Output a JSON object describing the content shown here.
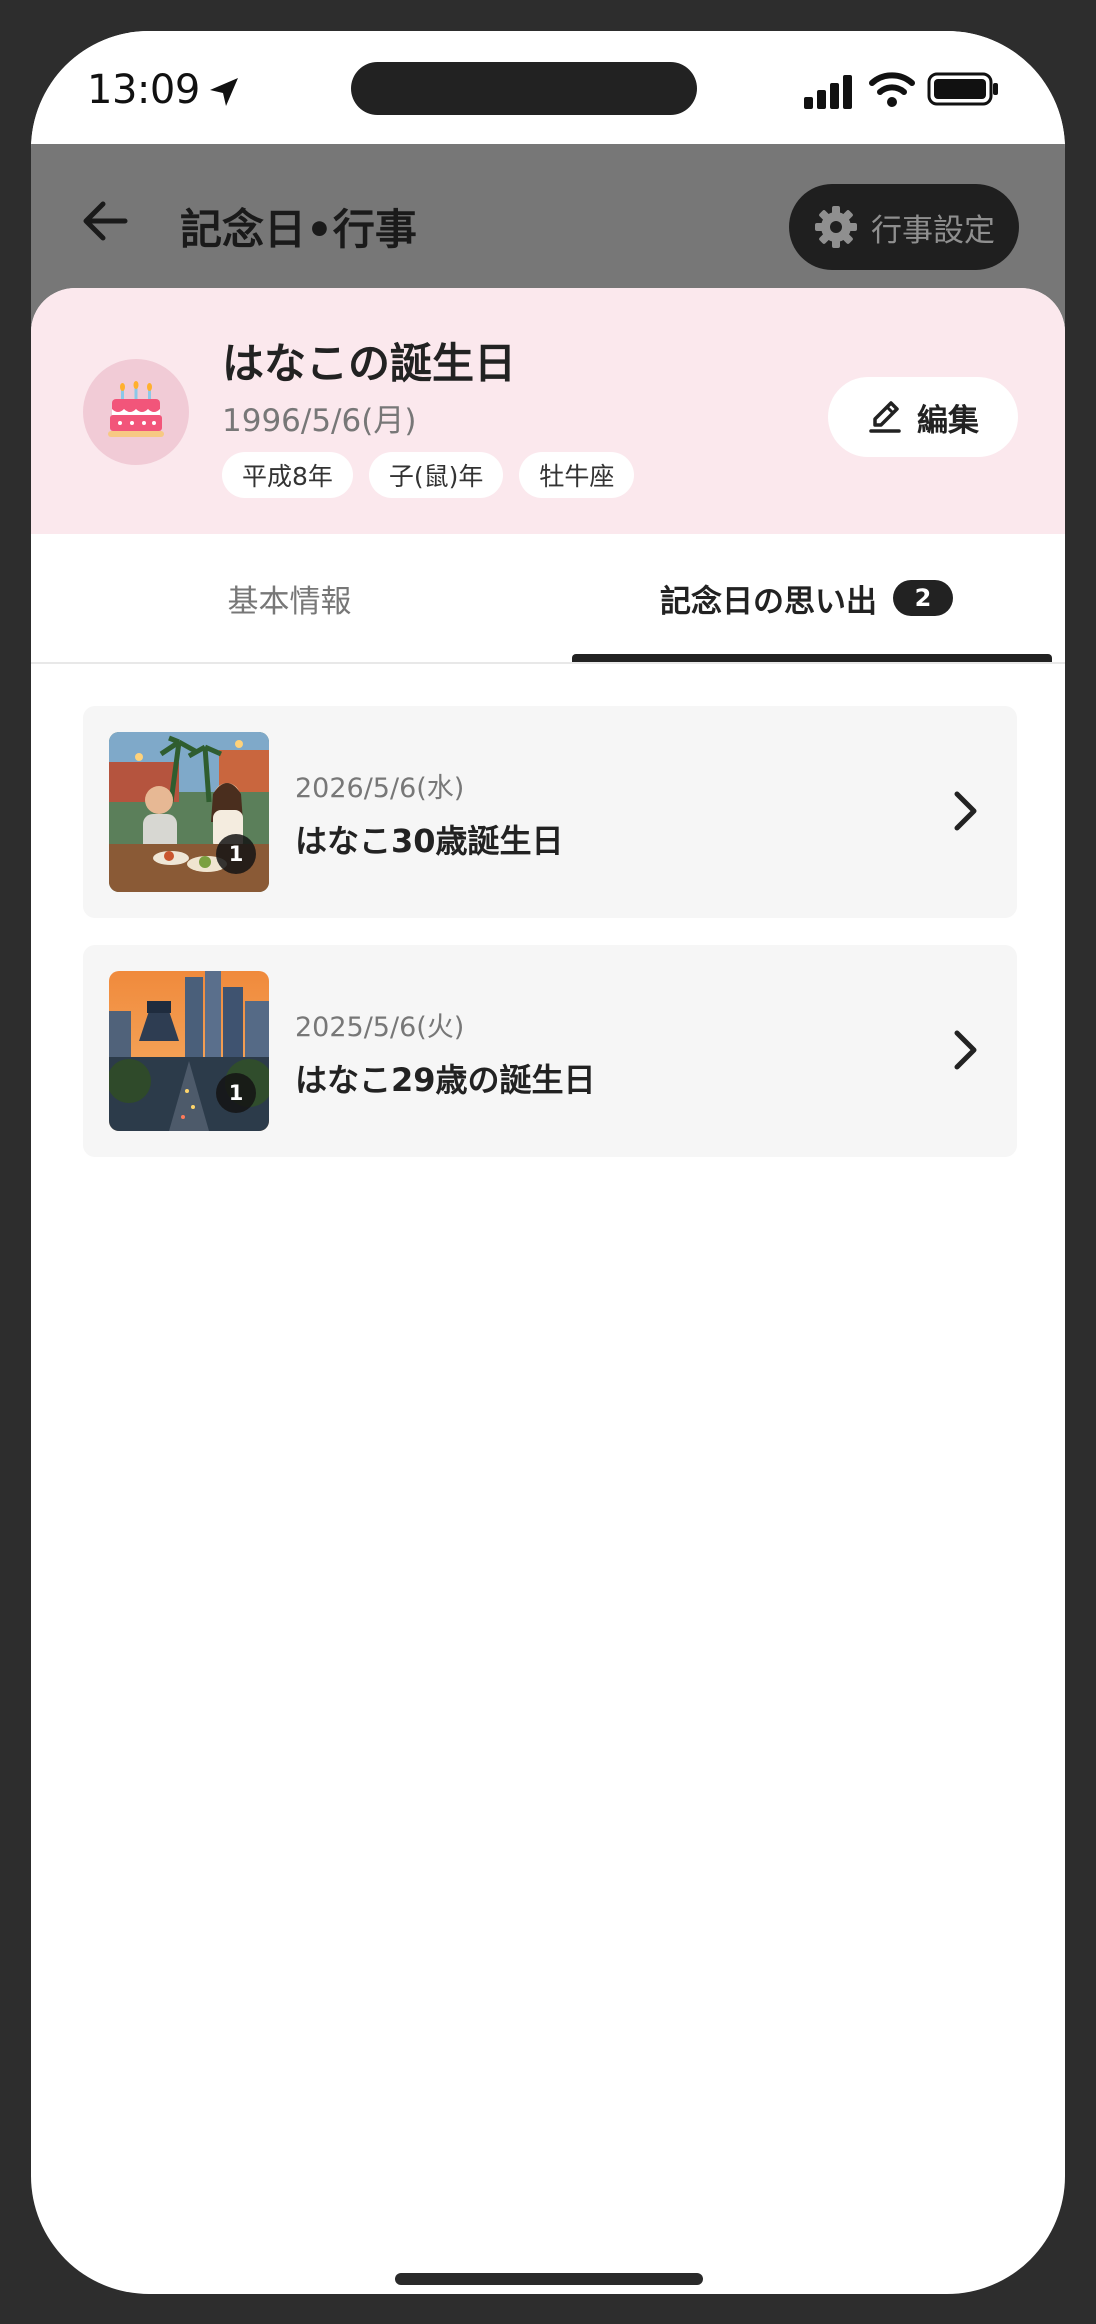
{
  "status_bar": {
    "time": "13:09"
  },
  "header": {
    "title": "記念日•行事",
    "settings_label": "行事設定"
  },
  "event": {
    "title": "はなこの誕生日",
    "date": "1996/5/6(月)",
    "tags": [
      "平成8年",
      "子(鼠)年",
      "牡牛座"
    ],
    "edit_label": "編集",
    "icon": "birthday-cake-icon"
  },
  "tabs": {
    "basic": "基本情報",
    "memories": "記念日の思い出",
    "memories_count": "2",
    "active": "memories"
  },
  "memories": [
    {
      "date": "2026/5/6(水)",
      "title": "はなこ30歳誕生日",
      "photo_count": "1"
    },
    {
      "date": "2025/5/6(火)",
      "title": "はなこ29歳の誕生日",
      "photo_count": "1"
    }
  ],
  "colors": {
    "pink_header": "#fbe8ed",
    "dim_overlay": "#777777",
    "dark": "#222222"
  }
}
